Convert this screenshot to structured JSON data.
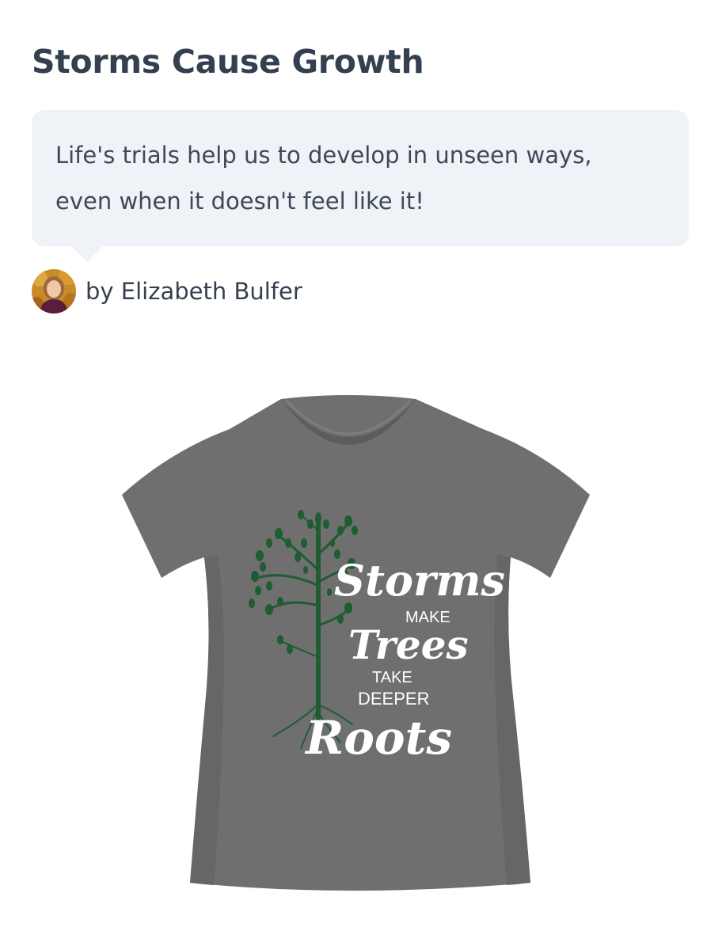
{
  "post": {
    "title": "Storms Cause Growth",
    "description_line1": "Life's trials help us to develop in unseen ways,",
    "description_line2": "even when it doesn't feel like it!",
    "author_label": "by Elizabeth Bulfer"
  },
  "product": {
    "shirt_color": "#707070",
    "tree_color": "#1f5c32",
    "print_lines": {
      "line1": "Storms",
      "line2": "MAKE",
      "line3": "Trees",
      "line4": "TAKE",
      "line5": "DEEPER",
      "line6": "Roots"
    }
  },
  "colors": {
    "heading": "#34404f",
    "bubble_bg": "#eff2f7"
  }
}
